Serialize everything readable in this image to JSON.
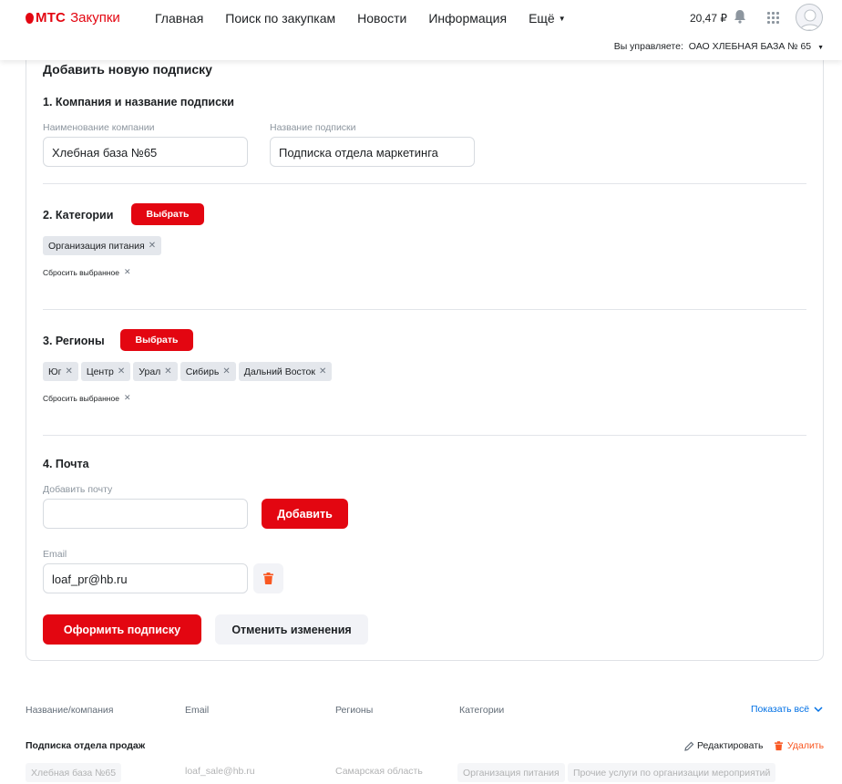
{
  "header": {
    "brand": "МТС",
    "brand_sub": "Закупки",
    "nav": [
      "Главная",
      "Поиск по закупкам",
      "Новости",
      "Информация"
    ],
    "more_label": "Ещё",
    "balance": "20,47 ₽",
    "manager_label": "Вы управляете:",
    "manager_org": "ОАО ХЛЕБНАЯ БАЗА № 65"
  },
  "form": {
    "title": "Добавить новую подписку",
    "section1": {
      "title": "1. Компания и название подписки",
      "company_label": "Наименование компании",
      "company_value": "Хлебная база №65",
      "name_label": "Название подписки",
      "name_value": "Подписка отдела маркетинга"
    },
    "section2": {
      "title": "2. Категории",
      "select_label": "Выбрать",
      "chips": [
        "Организация питания"
      ],
      "reset_label": "Сбросить выбранное"
    },
    "section3": {
      "title": "3. Регионы",
      "select_label": "Выбрать",
      "chips": [
        "Юг",
        "Центр",
        "Урал",
        "Сибирь",
        "Дальний Восток"
      ],
      "reset_label": "Сбросить выбранное"
    },
    "section4": {
      "title": "4. Почта",
      "add_label": "Добавить почту",
      "add_value": "",
      "add_button": "Добавить",
      "email_label": "Email",
      "email_value": "loaf_pr@hb.ru"
    },
    "submit_label": "Оформить подписку",
    "cancel_label": "Отменить изменения"
  },
  "table": {
    "headers": [
      "Название/компания",
      "Email",
      "Регионы",
      "Категории"
    ],
    "show_all": "Показать всё",
    "rows": [
      {
        "title": "Подписка отдела продаж",
        "edit_label": "Редактировать",
        "delete_label": "Удалить",
        "company": "Хлебная база №65",
        "email": "loaf_sale@hb.ru",
        "region": "Самарская область",
        "categories": [
          "Организация питания",
          "Прочие услуги по организации мероприятий"
        ]
      }
    ]
  },
  "colors": {
    "accent": "#e30611",
    "link": "#0070e5",
    "chip_bg": "#e4e7ec",
    "delete": "#f95721"
  }
}
